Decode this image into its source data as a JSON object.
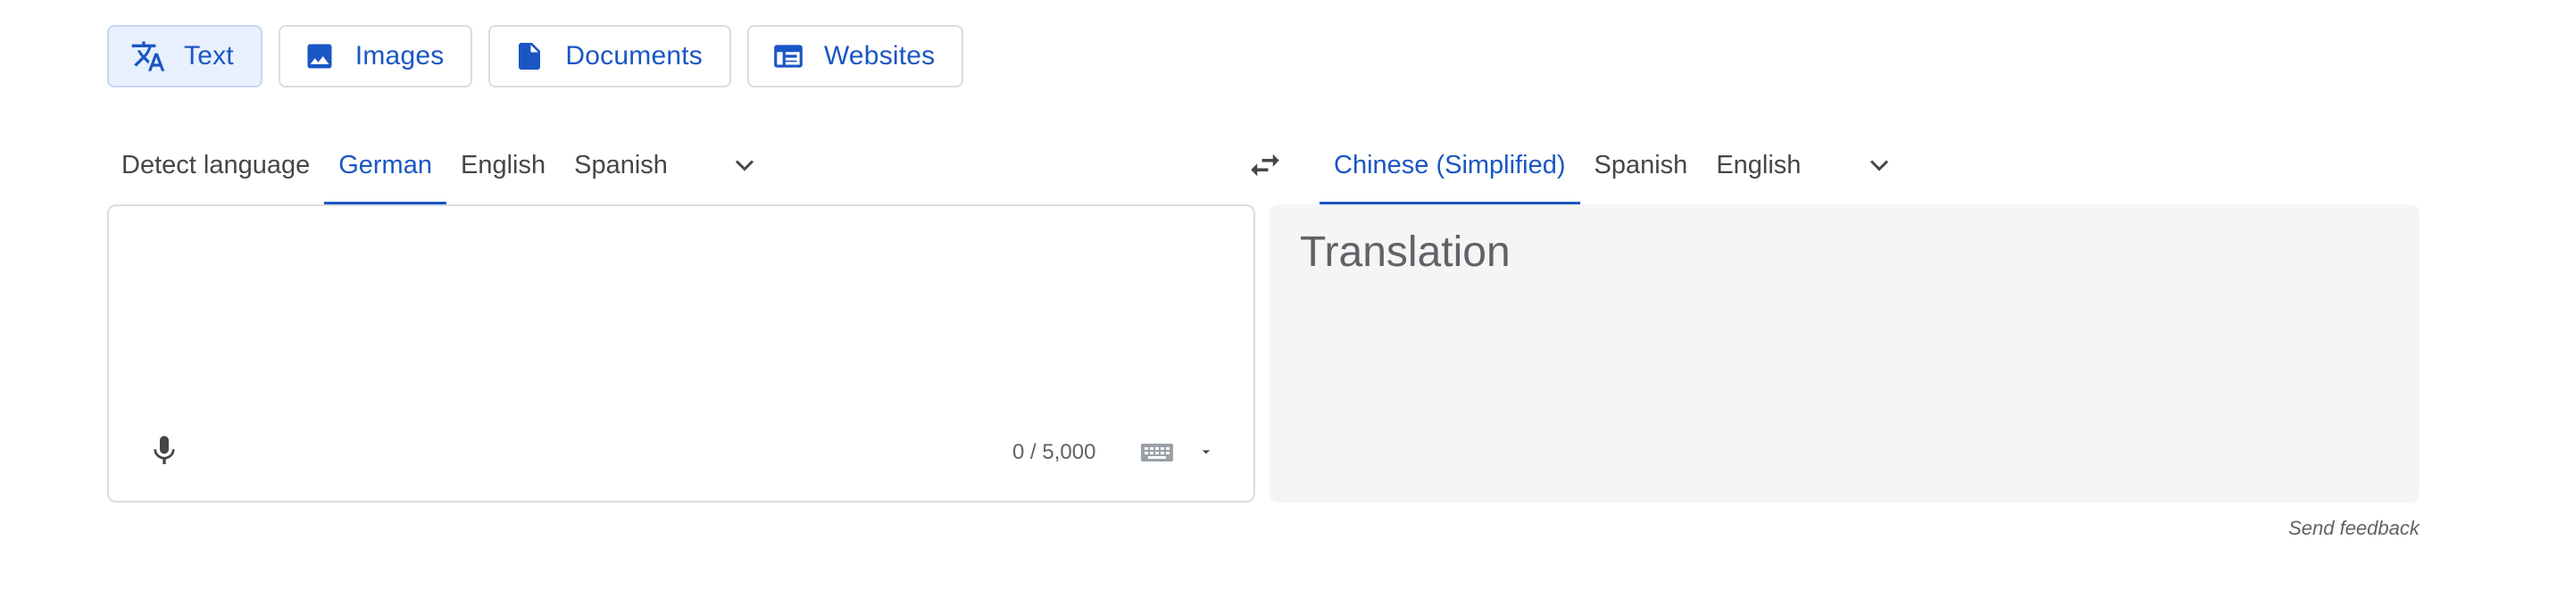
{
  "modes": [
    {
      "label": "Text",
      "icon": "translate-icon",
      "active": true
    },
    {
      "label": "Images",
      "icon": "image-icon",
      "active": false
    },
    {
      "label": "Documents",
      "icon": "document-icon",
      "active": false
    },
    {
      "label": "Websites",
      "icon": "website-icon",
      "active": false
    }
  ],
  "source_languages": {
    "items": [
      "Detect language",
      "German",
      "English",
      "Spanish"
    ],
    "selected": "German"
  },
  "target_languages": {
    "items": [
      "Chinese (Simplified)",
      "Spanish",
      "English"
    ],
    "selected": "Chinese (Simplified)"
  },
  "source_panel": {
    "text": "",
    "char_count": "0 / 5,000"
  },
  "target_panel": {
    "placeholder": "Translation"
  },
  "feedback_label": "Send feedback",
  "colors": {
    "accent": "#1a56c4",
    "active_mode_bg": "#e8f0fe",
    "target_panel_bg": "#f5f5f5",
    "border": "#dadce0"
  }
}
